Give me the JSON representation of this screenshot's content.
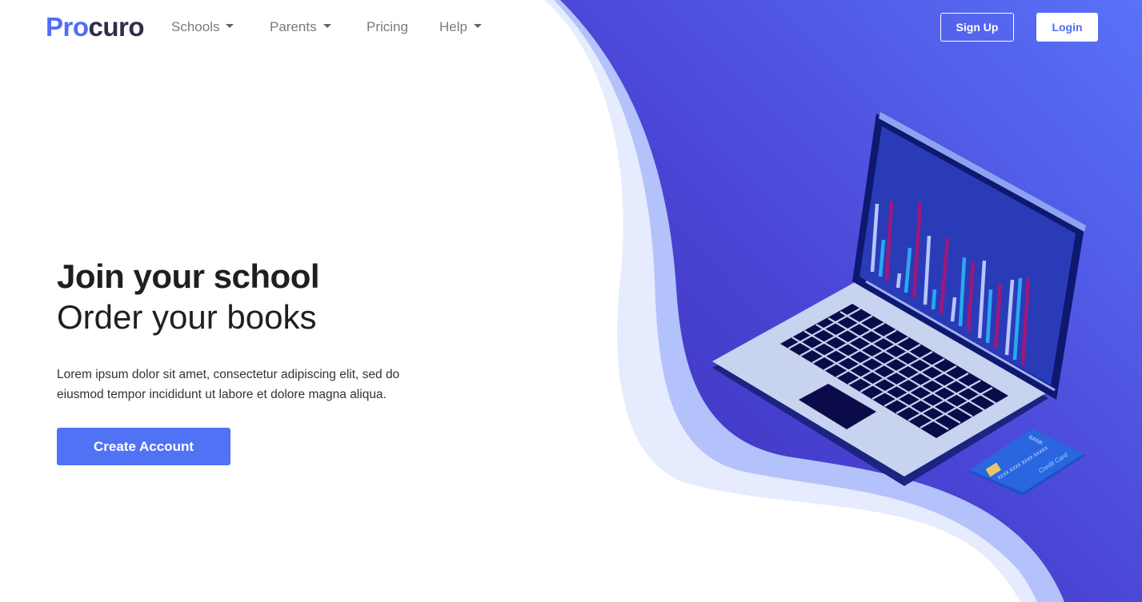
{
  "brand": {
    "part1": "Pro",
    "part2": "curo"
  },
  "nav": {
    "items": [
      {
        "label": "Schools",
        "dropdown": true
      },
      {
        "label": "Parents",
        "dropdown": true
      },
      {
        "label": "Pricing",
        "dropdown": false
      },
      {
        "label": "Help",
        "dropdown": true
      }
    ],
    "signup_label": "Sign Up",
    "login_label": "Login"
  },
  "hero": {
    "title": "Join your school",
    "subtitle": "Order your books",
    "description": "Lorem ipsum dolor sit amet, consectetur adipiscing elit, sed do eiusmod tempor incididunt ut labore et dolore magna aliqua.",
    "cta_label": "Create Account"
  },
  "illustration": {
    "card": {
      "bank": "BANK",
      "number": "XXXX  XXXX  XXXX  XXXXX",
      "type": "Credit Card"
    }
  },
  "colors": {
    "brand_blue": "#4f6ef7",
    "brand_dark": "#2e2d4a",
    "gradient_start": "#5a6ff2",
    "gradient_end": "#3d31b8",
    "wave_light": "#e6ecfd",
    "wave_mid": "#b4c2fb"
  }
}
